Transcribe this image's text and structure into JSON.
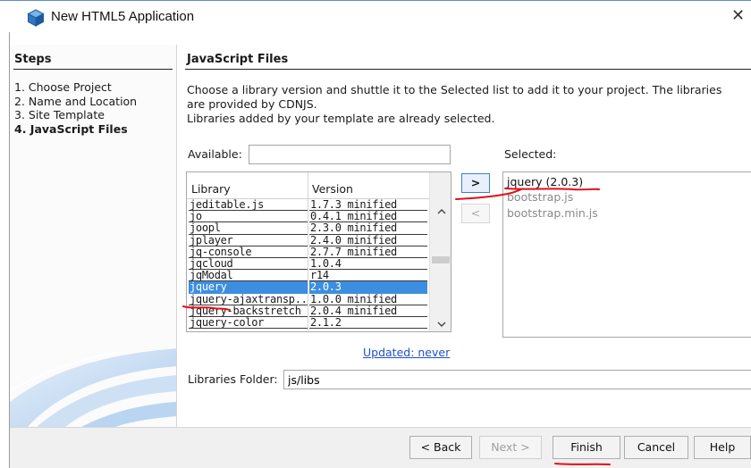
{
  "window": {
    "title": "New HTML5 Application",
    "close_glyph": "✕",
    "icon": "netbeans-cube-icon"
  },
  "steps": {
    "heading": "Steps",
    "items": [
      {
        "label": "1.  Choose Project"
      },
      {
        "label": "2.  Name and Location"
      },
      {
        "label": "3.  Site Template"
      },
      {
        "label": "4.  JavaScript Files"
      }
    ]
  },
  "content": {
    "heading": "JavaScript Files",
    "description_line1": "Choose a library version and shuttle it to the Selected list to add it to your project. The libraries",
    "description_line2": "are provided by CDNJS.",
    "description_line3": "Libraries added by your template are already selected.",
    "available_label": "Available:",
    "available_value": "",
    "selected_label": "Selected:",
    "updated_link": "Updated: never",
    "folder_label": "Libraries Folder:",
    "folder_value": "js/libs"
  },
  "library_table": {
    "columns": [
      "Library",
      "Version"
    ],
    "rows": [
      {
        "library": "jeditable.js",
        "version": "1.7.3 minified"
      },
      {
        "library": "jo",
        "version": "0.4.1 minified"
      },
      {
        "library": "joopl",
        "version": "2.3.0 minified"
      },
      {
        "library": "jplayer",
        "version": "2.4.0 minified"
      },
      {
        "library": "jq-console",
        "version": "2.7.7 minified"
      },
      {
        "library": "jqcloud",
        "version": "1.0.4"
      },
      {
        "library": "jqModal",
        "version": "r14"
      },
      {
        "library": "jquery",
        "version": "2.0.3",
        "selected": true
      },
      {
        "library": "jquery-ajaxtransp...",
        "version": "1.0.0 minified"
      },
      {
        "library": "jquery-backstretch",
        "version": "2.0.4 minified"
      },
      {
        "library": "jquery-color",
        "version": "2.1.2"
      }
    ]
  },
  "selected_list": {
    "items": [
      {
        "label": "jquery (2.0.3)",
        "from_template": false
      },
      {
        "label": "bootstrap.js",
        "from_template": true
      },
      {
        "label": "bootstrap.min.js",
        "from_template": true
      }
    ]
  },
  "shuttle": {
    "add_label": ">",
    "remove_label": "<"
  },
  "buttons": {
    "back": "< Back",
    "next": "Next >",
    "finish": "Finish",
    "cancel": "Cancel",
    "help": "Help"
  },
  "colors": {
    "selection": "#3d8ee0",
    "link": "#2050c8",
    "annotation": "#e0101a"
  }
}
